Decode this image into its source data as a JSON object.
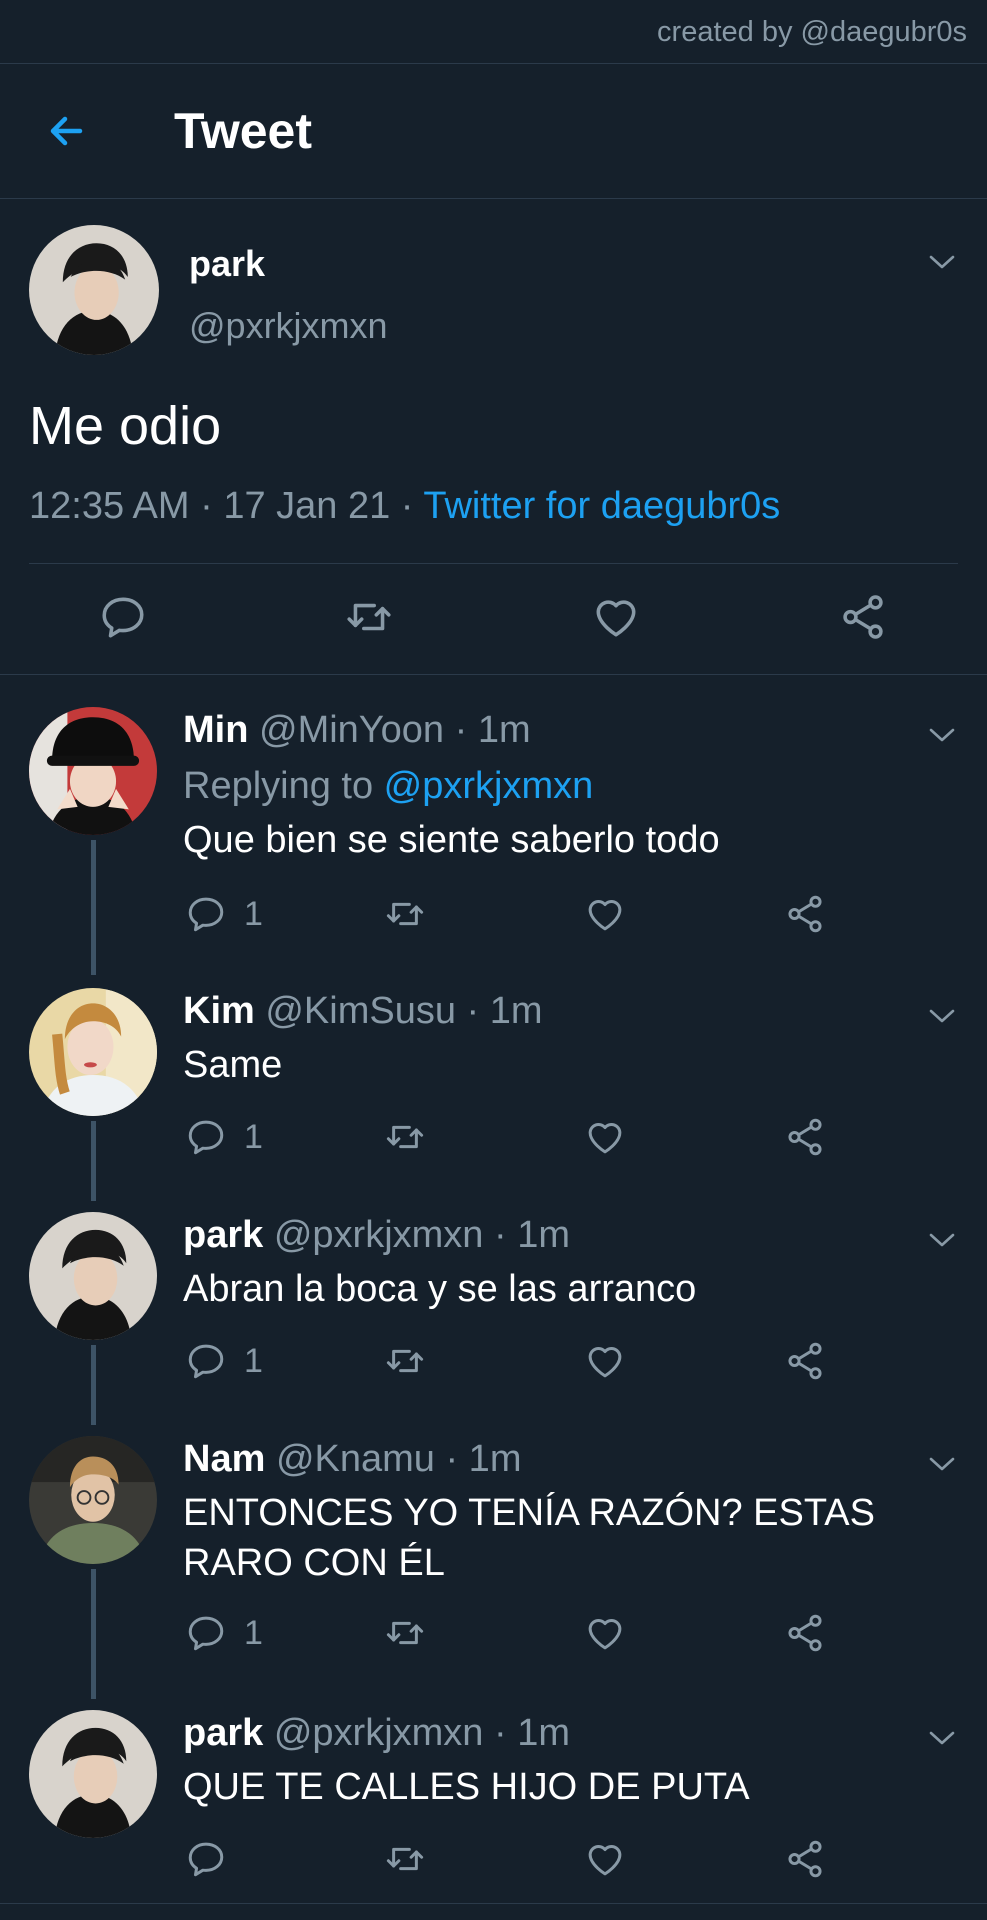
{
  "credit": "created by @daegubr0s",
  "header": {
    "title": "Tweet"
  },
  "tweet": {
    "name": "park",
    "handle": "@pxrkjxmxn",
    "text": "Me odio",
    "time": "12:35 AM · 17 Jan 21 · ",
    "source": "Twitter for daegubr0s"
  },
  "replies": [
    {
      "name": "Min",
      "handle": "@MinYoon · 1m",
      "replying_label": "Replying to ",
      "replying_to": "@pxrkjxmxn",
      "text": "Que bien se siente saberlo todo",
      "reply_count": "1"
    },
    {
      "name": "Kim",
      "handle": "@KimSusu · 1m",
      "text": "Same",
      "reply_count": "1"
    },
    {
      "name": "park",
      "handle": "@pxrkjxmxn · 1m",
      "text": "Abran la boca y se las arranco",
      "reply_count": "1"
    },
    {
      "name": "Nam",
      "handle": "@Knamu · 1m",
      "text": "ENTONCES YO TENÍA RAZÓN? ESTAS RARO CON ÉL",
      "reply_count": "1"
    },
    {
      "name": "park",
      "handle": "@pxrkjxmxn · 1m",
      "text": "QUE TE CALLES HIJO DE PUTA",
      "reply_count": ""
    }
  ],
  "colors": {
    "background": "#15202b",
    "accent": "#1da1f2",
    "muted": "#8899a6",
    "divider": "#2b3a4a"
  },
  "icons": [
    "back-arrow-icon",
    "chevron-down-icon",
    "reply-icon",
    "retweet-icon",
    "like-icon",
    "share-icon"
  ]
}
